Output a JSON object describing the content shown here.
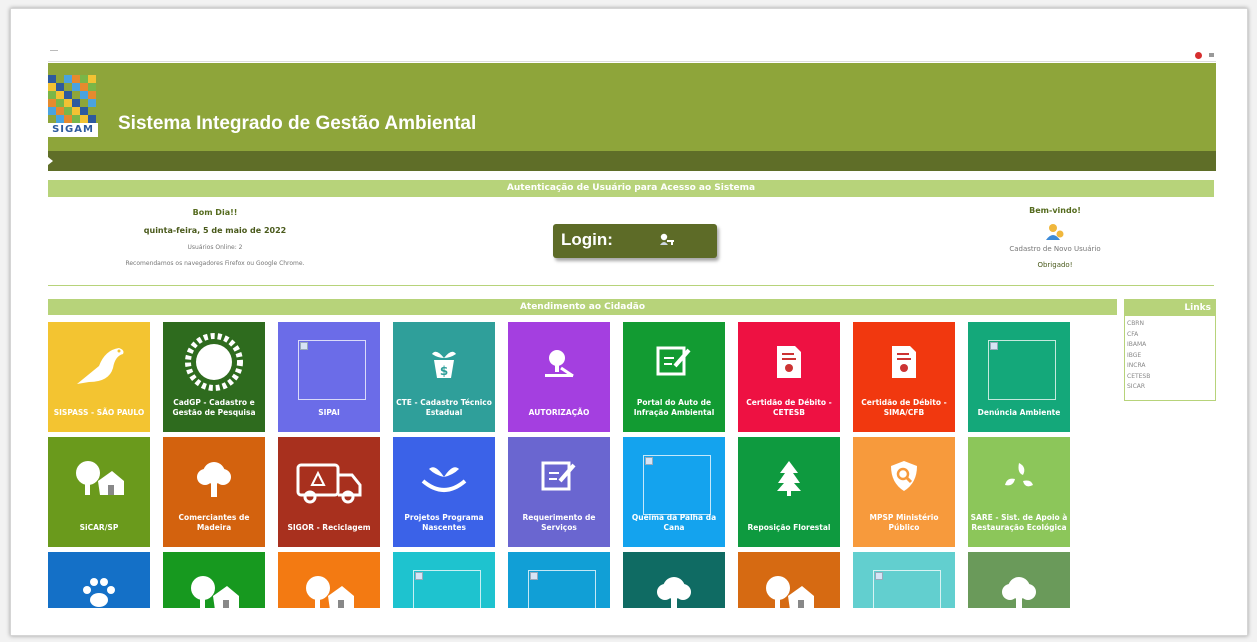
{
  "header": {
    "logo_text": "SIGAM",
    "title": "Sistema Integrado de Gestão Ambiental"
  },
  "auth": {
    "bar_title": "Autenticação de Usuário para Acesso ao Sistema",
    "greeting": "Bom Dia!!",
    "date": "quinta-feira, 5 de maio de 2022",
    "users_online": "Usuários Online: 2",
    "browser_note": "Recomendamos os navegadores Firefox ou Google Chrome.",
    "login_label": "Login:",
    "welcome": "Bem-vindo!",
    "register_link": "Cadastro de Novo Usuário",
    "thanks": "Obrigado!"
  },
  "citizen": {
    "bar_title": "Atendimento ao Cidadão"
  },
  "links": {
    "title": "Links",
    "items": [
      "CBRN",
      "CFA",
      "IBAMA",
      "IBGE",
      "INCRA",
      "CETESB",
      "SICAR"
    ]
  },
  "tiles": [
    {
      "label": "SISPASS - SÃO PAULO",
      "color": "#f3c431",
      "icon": "bird-icon"
    },
    {
      "label": "CadGP - Cadastro e Gestão de Pesquisa",
      "color": "#2e6b1e",
      "icon": "leaf-wreath-icon"
    },
    {
      "label": "SIPAI",
      "color": "#6b6ce8",
      "icon": "broken-image-icon"
    },
    {
      "label": "CTE - Cadastro Técnico Estadual",
      "color": "#2f9f9a",
      "icon": "money-plant-icon"
    },
    {
      "label": "AUTORIZAÇÃO",
      "color": "#a43fe0",
      "icon": "tree-cut-icon"
    },
    {
      "label": "Portal do Auto de Infração Ambiental",
      "color": "#129b32",
      "icon": "document-pen-icon"
    },
    {
      "label": "Certidão de Débito - CETESB",
      "color": "#ee1142",
      "icon": "certificate-icon"
    },
    {
      "label": "Certidão de Débito - SIMA/CFB",
      "color": "#f1380f",
      "icon": "certificate-icon"
    },
    {
      "label": "Denúncia Ambiente",
      "color": "#14a87a",
      "icon": "broken-image-icon"
    },
    {
      "label": "SiCAR/SP",
      "color": "#6a9a1c",
      "icon": "rural-house-icon"
    },
    {
      "label": "Comerciantes de Madeira",
      "color": "#d3620e",
      "icon": "tree-icon"
    },
    {
      "label": "SIGOR - Reciclagem",
      "color": "#a8301e",
      "icon": "recycling-truck-icon"
    },
    {
      "label": "Projetos Programa Nascentes",
      "color": "#3b62e8",
      "icon": "hands-sprout-icon"
    },
    {
      "label": "Requerimento de Serviços",
      "color": "#6a66d0",
      "icon": "document-pen-icon"
    },
    {
      "label": "Queima da Palha da Cana",
      "color": "#14a3ee",
      "icon": "broken-image-icon"
    },
    {
      "label": "Reposição Florestal",
      "color": "#0e9a3f",
      "icon": "pine-tree-icon"
    },
    {
      "label": "MPSP Ministério Público",
      "color": "#f79a3c",
      "icon": "shield-search-icon"
    },
    {
      "label": "SARE - Sist. de Apoio à Restauração Ecológica",
      "color": "#8cc65a",
      "icon": "recycle-leaves-icon"
    },
    {
      "label": "",
      "color": "#1470c7",
      "icon": "paw-icon"
    },
    {
      "label": "",
      "color": "#17991f",
      "icon": "rural-house-icon"
    },
    {
      "label": "",
      "color": "#f37a12",
      "icon": "rural-house-icon"
    },
    {
      "label": "",
      "color": "#1ec3cf",
      "icon": "broken-image-icon"
    },
    {
      "label": "",
      "color": "#119fd6",
      "icon": "broken-image-icon"
    },
    {
      "label": "",
      "color": "#0f6b63",
      "icon": "tree-icon"
    },
    {
      "label": "",
      "color": "#d66a12",
      "icon": "rural-house-icon"
    },
    {
      "label": "",
      "color": "#62cfcf",
      "icon": "broken-image-icon"
    },
    {
      "label": "",
      "color": "#6a9a5a",
      "icon": "tree-icon"
    }
  ],
  "colors": {
    "header_green": "#8ea53a",
    "nav_green": "#5f6e28",
    "bar_green": "#b7d37a"
  }
}
